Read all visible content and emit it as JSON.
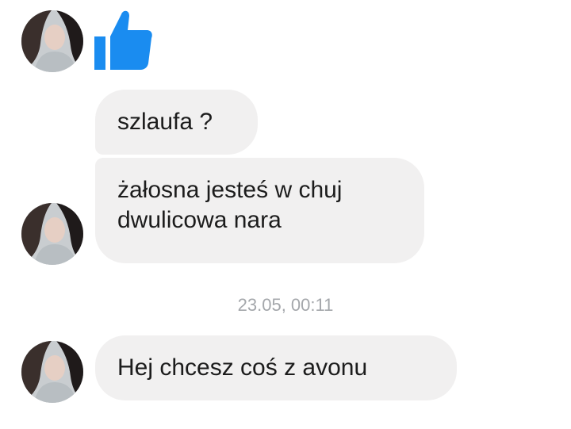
{
  "conversation": {
    "messages": [
      {
        "text": "szlaufa ?"
      },
      {
        "lines": [
          "żałosna jesteś w chuj",
          "dwulicowa nara"
        ]
      },
      {
        "text": "Hej chcesz coś z avonu"
      }
    ],
    "timestamp": "23.05, 00:11"
  },
  "icons": {
    "like": "thumbs-up-icon",
    "avatar": "profile-photo"
  },
  "colors": {
    "like_blue": "#1a8cf0",
    "bubble_bg": "#f1f0f0",
    "timestamp_text": "#a4a7ab"
  }
}
